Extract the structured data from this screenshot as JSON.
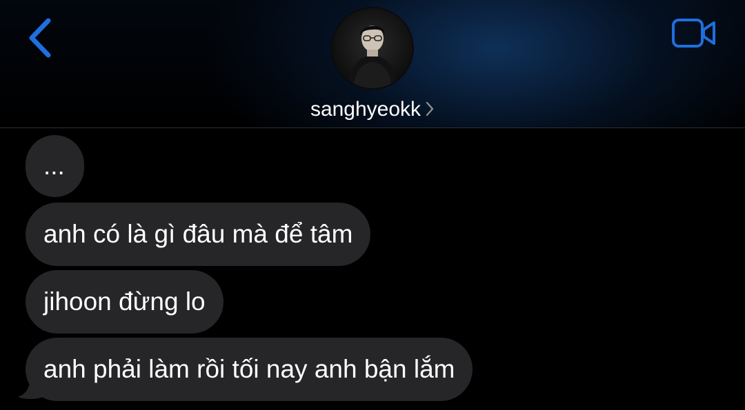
{
  "header": {
    "contact_name": "sanghyeokk",
    "accent_color": "#1e6fe0",
    "back_icon": "chevron-left-icon",
    "video_icon": "video-camera-icon",
    "name_chevron_icon": "chevron-right-icon"
  },
  "messages": [
    {
      "sender": "sanghyeokk",
      "text": "..."
    },
    {
      "sender": "sanghyeokk",
      "text": "anh có là gì đâu mà để tâm"
    },
    {
      "sender": "sanghyeokk",
      "text": "jihoon đừng lo"
    },
    {
      "sender": "sanghyeokk",
      "text": "anh phải làm rồi tối nay anh bận lắm"
    }
  ],
  "colors": {
    "background": "#000000",
    "bubble_incoming": "#262628",
    "text": "#ffffff"
  }
}
